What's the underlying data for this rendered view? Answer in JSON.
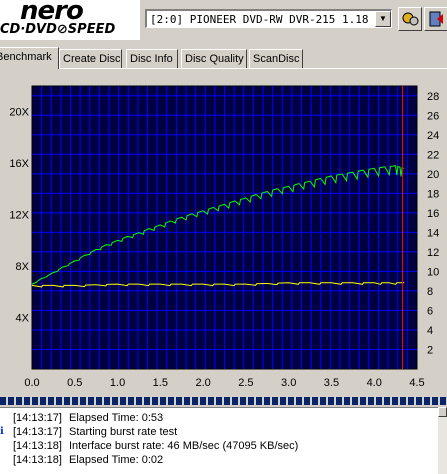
{
  "app": {
    "logo_top": "nero",
    "logo_bottom": "CD·DVD⊘SPEED"
  },
  "drive": {
    "selected": "[2:0]  PIONEER DVD-RW  DVR-215 1.18"
  },
  "toolbar": {
    "icons": [
      "drive-settings-icon",
      "exit-icon"
    ]
  },
  "tabs": [
    {
      "label": "Benchmark",
      "active": true
    },
    {
      "label": "Create Disc"
    },
    {
      "label": "Disc Info"
    },
    {
      "label": "Disc Quality"
    },
    {
      "label": "ScanDisc"
    }
  ],
  "chart_data": {
    "type": "line",
    "x_ticks": [
      "0.0",
      "0.5",
      "1.0",
      "1.5",
      "2.0",
      "2.5",
      "3.0",
      "3.5",
      "4.0",
      "4.5"
    ],
    "y_left_ticks": [
      "4X",
      "8X",
      "12X",
      "16X",
      "20X"
    ],
    "y_right_ticks": [
      "2",
      "4",
      "6",
      "8",
      "10",
      "12",
      "14",
      "16",
      "18",
      "20",
      "22",
      "24",
      "26",
      "28"
    ],
    "xlim": [
      0,
      4.5
    ],
    "ylim_left": [
      0,
      22
    ],
    "ylim_right": [
      0,
      29
    ],
    "grid": true,
    "background": "#000040",
    "grid_color": "#0000ff",
    "marker_x": 4.33,
    "series": [
      {
        "color": "#00ff00",
        "x": [
          0,
          0.25,
          0.5,
          0.75,
          1,
          1.25,
          1.5,
          1.75,
          2,
          2.25,
          2.5,
          2.75,
          3,
          3.25,
          3.5,
          3.75,
          4,
          4.25,
          4.35
        ],
        "values": [
          6.6,
          7.5,
          8.4,
          9.3,
          10.0,
          10.6,
          11.2,
          11.8,
          12.3,
          12.8,
          13.3,
          13.8,
          14.2,
          14.6,
          15.0,
          15.3,
          15.6,
          15.8,
          15.6
        ]
      },
      {
        "color": "#ffff00",
        "x": [
          0,
          0.5,
          1,
          1.5,
          2,
          2.5,
          3,
          3.5,
          4,
          4.35
        ],
        "values": [
          6.5,
          6.5,
          6.6,
          6.6,
          6.6,
          6.6,
          6.7,
          6.7,
          6.7,
          6.7
        ]
      }
    ]
  },
  "log": [
    {
      "time": "[14:13:17]",
      "text": "Elapsed Time:  0:53",
      "icon": ""
    },
    {
      "time": "[14:13:17]",
      "text": "Starting burst rate test",
      "icon": "info-icon"
    },
    {
      "time": "[14:13:18]",
      "text": "Interface burst rate: 46 MB/sec (47095 KB/sec)",
      "icon": ""
    },
    {
      "time": "[14:13:18]",
      "text": "Elapsed Time:  0:02",
      "icon": ""
    }
  ]
}
